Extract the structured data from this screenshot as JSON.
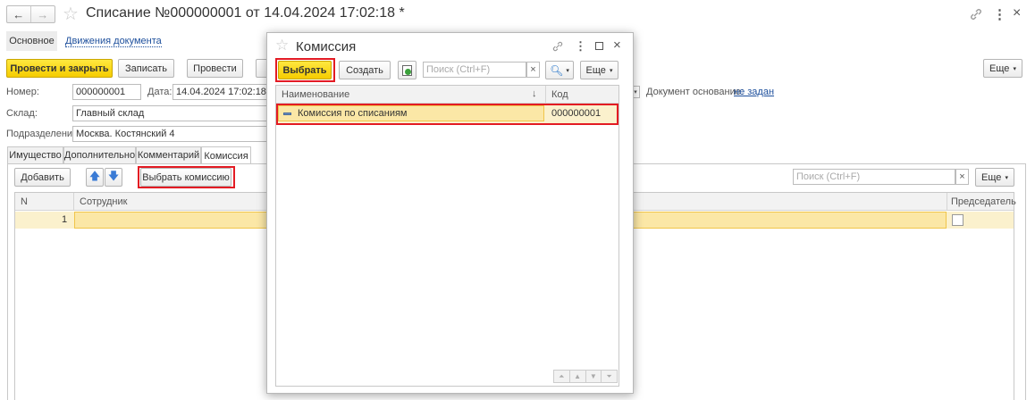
{
  "window": {
    "title": "Списание №000000001 от 14.04.2024 17:02:18 *",
    "back": "←",
    "forward": "→",
    "star": "☆",
    "link_icon": "link-icon",
    "menu_dots": "⋮",
    "close": "×"
  },
  "nav": {
    "main": "Основное",
    "movements": "Движения документа"
  },
  "toolbar": {
    "post_close": "Провести и закрыть",
    "save": "Записать",
    "post": "Провести",
    "more": "Еще"
  },
  "form": {
    "number_label": "Номер:",
    "number_value": "000000001",
    "date_label": "Дата:",
    "date_value": "14.04.2024 17:02:18",
    "basis_label": "Документ основание:",
    "basis_value": "не задан",
    "warehouse_label": "Склад:",
    "warehouse_value": "Главный склад",
    "division_label": "Подразделение:",
    "division_value": "Москва. Костянский 4"
  },
  "tabs": [
    "Имущество",
    "Дополнительно",
    "Комментарий",
    "Комиссия"
  ],
  "commission": {
    "add": "Добавить",
    "choose_commission": "Выбрать комиссию",
    "search_placeholder": "Поиск (Ctrl+F)",
    "more": "Еще",
    "columns": {
      "n": "N",
      "employee": "Сотрудник",
      "chairman": "Председатель"
    },
    "rows": [
      {
        "n": "1",
        "employee": ""
      }
    ]
  },
  "dialog": {
    "title": "Комиссия",
    "choose": "Выбрать",
    "create": "Создать",
    "search_placeholder": "Поиск (Ctrl+F)",
    "more": "Еще",
    "columns": {
      "name": "Наименование",
      "code": "Код",
      "sort_arrow": "↓"
    },
    "rows": [
      {
        "name": "Комиссия по списаниям",
        "code": "000000001"
      }
    ]
  },
  "colors": {
    "accent_yellow": "#f5cc00",
    "selected_row": "#fbe7a6",
    "highlight_red": "#e31b23",
    "link": "#1d4f9c"
  }
}
